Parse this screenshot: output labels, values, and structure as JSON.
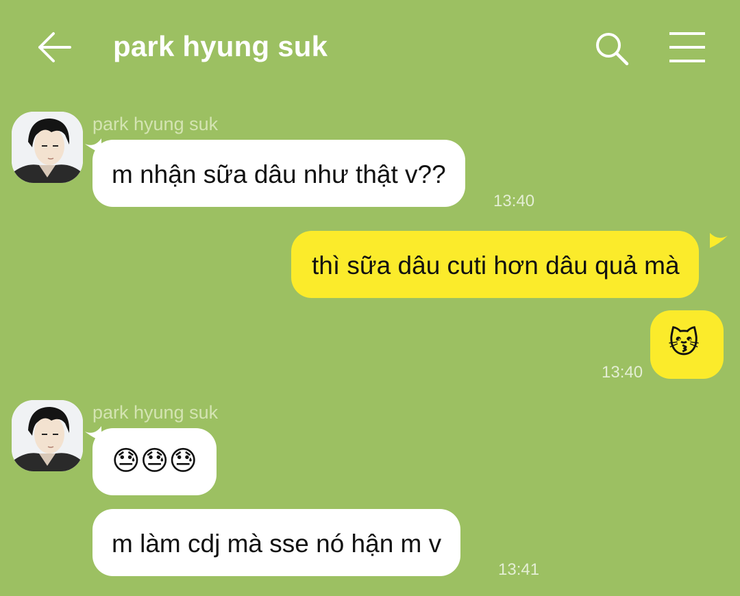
{
  "header": {
    "title": "park hyung suk",
    "back_icon": "arrow-left-icon",
    "search_icon": "search-icon",
    "menu_icon": "hamburger-menu-icon"
  },
  "colors": {
    "background": "#9cc062",
    "incoming_bubble": "#ffffff",
    "outgoing_bubble": "#fbeb2b"
  },
  "messages": [
    {
      "sender": "park hyung suk",
      "text": "m nhận sữa dâu như thật v??",
      "time": "13:40",
      "direction": "incoming"
    },
    {
      "text": "thì sữa dâu cuti hơn dâu quả mà",
      "direction": "outgoing"
    },
    {
      "text": "😽",
      "time": "13:40",
      "direction": "outgoing"
    },
    {
      "sender": "park hyung suk",
      "text": "😓😓😓",
      "direction": "incoming"
    },
    {
      "text": "m làm cdj mà sse nó hận m v",
      "time": "13:41",
      "direction": "incoming"
    }
  ]
}
